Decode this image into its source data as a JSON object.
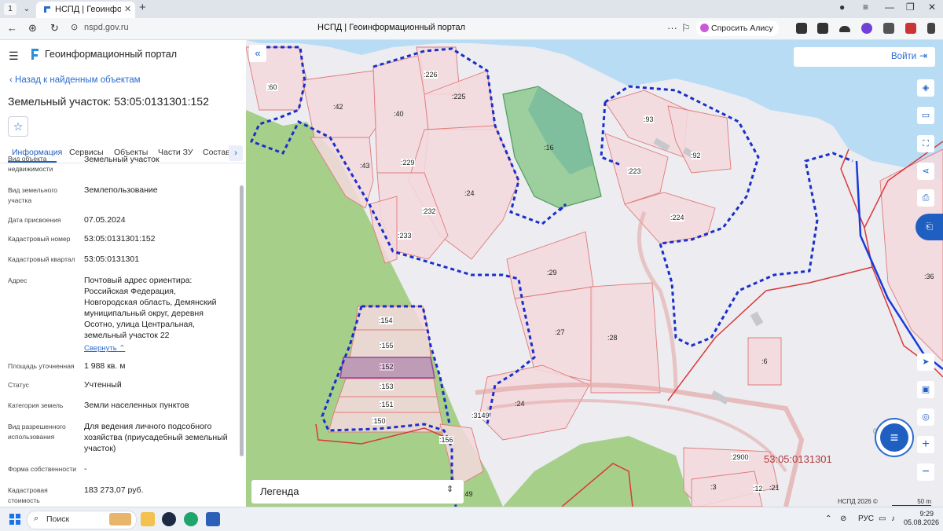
{
  "browser": {
    "tab_number": "1",
    "tab_title": "НСПД | Геоинформаци",
    "url": "nspd.gov.ru",
    "page_title": "НСПД | Геоинформационный портал",
    "alice_label": "Спросить Алису AI"
  },
  "sidebar": {
    "app_title": "Геоинформационный портал",
    "back_link": "Назад к найденным объектам",
    "object_title": "Земельный участок: 53:05:0131301:152",
    "tabs": [
      "Информация",
      "Сервисы",
      "Объекты",
      "Части ЗУ",
      "Состав"
    ],
    "fields": [
      {
        "label": "Вид объекта недвижимости",
        "value": "Земельный участок"
      },
      {
        "label": "Вид земельного участка",
        "value": "Землепользование"
      },
      {
        "label": "Дата присвоения",
        "value": "07.05.2024"
      },
      {
        "label": "Кадастровый номер",
        "value": "53:05:0131301:152"
      },
      {
        "label": "Кадастровый квартал",
        "value": "53:05:0131301"
      },
      {
        "label": "Адрес",
        "value": "Почтовый адрес ориентира: Российская Федерация, Новгородская область, Демянский муниципальный округ, деревня Осотно, улица Центральная, земельный участок 22"
      },
      {
        "label": "Площадь уточненная",
        "value": "1 988 кв. м"
      },
      {
        "label": "Статус",
        "value": "Учтенный"
      },
      {
        "label": "Категория земель",
        "value": "Земли населенных пунктов"
      },
      {
        "label": "Вид разрешенного использования",
        "value": "Для ведения личного подсобного хозяйства (приусадебный земельный участок)"
      },
      {
        "label": "Форма собственности",
        "value": "-"
      },
      {
        "label": "Кадастровая стоимость",
        "value": "183 273,07 руб."
      }
    ],
    "collapse_link": "Свернуть"
  },
  "map": {
    "login_label": "Войти",
    "legend_label": "Легенда",
    "quarter_label": "53:05:0131301",
    "copyright": "НСПД 2026 ©",
    "scale": "50 m",
    "parcel_labels": [
      ":60",
      ":42",
      ":40",
      ":226",
      ":225",
      ":43",
      ":229",
      ":24",
      ":232",
      ":233",
      ":16",
      ":93",
      ":92",
      ":223",
      ":224",
      ":29",
      ":27",
      ":28",
      ":6",
      ":36",
      ":154",
      ":155",
      ":152",
      ":153",
      ":151",
      ":150",
      ":156",
      ":3149",
      ":24",
      ":2900",
      ":3",
      ":12",
      ":21",
      ":49",
      "0"
    ]
  },
  "taskbar": {
    "search_label": "Поиск",
    "lang": "РУС",
    "time": "9:29",
    "date": "05.08.2026"
  },
  "colors": {
    "accent": "#1f5fc2",
    "parcel_fill": "#f3d9dd",
    "parcel_stroke": "#e07a78",
    "green": "#a6cf8a",
    "water": "#b9dcf5",
    "quarter_border": "#1a2fc8",
    "selected": "#9b3fa0"
  }
}
